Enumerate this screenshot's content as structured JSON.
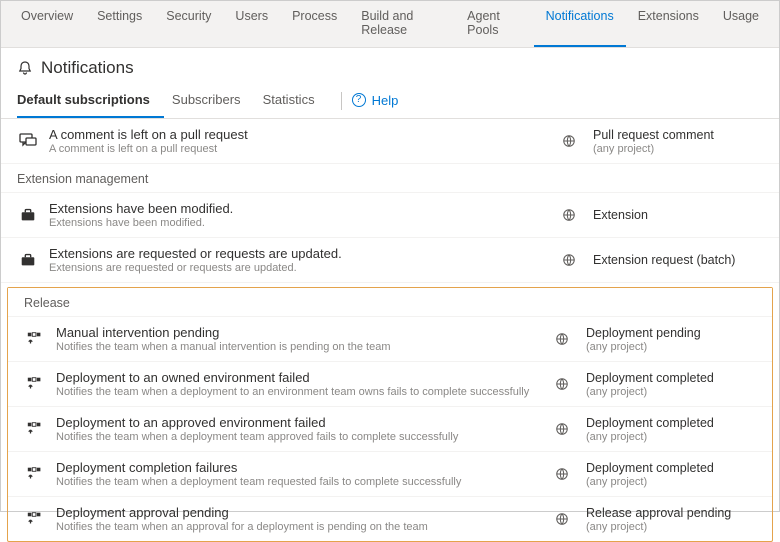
{
  "topnav": {
    "tabs": [
      {
        "label": "Overview"
      },
      {
        "label": "Settings"
      },
      {
        "label": "Security"
      },
      {
        "label": "Users"
      },
      {
        "label": "Process"
      },
      {
        "label": "Build and Release"
      },
      {
        "label": "Agent Pools"
      },
      {
        "label": "Notifications"
      },
      {
        "label": "Extensions"
      },
      {
        "label": "Usage"
      }
    ],
    "selected": "Notifications"
  },
  "page": {
    "title": "Notifications"
  },
  "subnav": {
    "tabs": [
      {
        "label": "Default subscriptions"
      },
      {
        "label": "Subscribers"
      },
      {
        "label": "Statistics"
      }
    ],
    "selected": "Default subscriptions",
    "help": "Help"
  },
  "top_row": {
    "title": "A comment is left on a pull request",
    "desc": "A comment is left on a pull request",
    "category": "Pull request comment",
    "scope": "(any project)"
  },
  "ext_section": {
    "header": "Extension management",
    "rows": [
      {
        "title": "Extensions have been modified.",
        "desc": "Extensions have been modified.",
        "category": "Extension",
        "scope": ""
      },
      {
        "title": "Extensions are requested or requests are updated.",
        "desc": "Extensions are requested or requests are updated.",
        "category": "Extension request (batch)",
        "scope": ""
      }
    ]
  },
  "release_section": {
    "header": "Release",
    "rows": [
      {
        "title": "Manual intervention pending",
        "desc": "Notifies the team when a manual intervention is pending on the team",
        "category": "Deployment pending",
        "scope": "(any project)"
      },
      {
        "title": "Deployment to an owned environment failed",
        "desc": "Notifies the team when a deployment to an environment team owns fails to complete successfully",
        "category": "Deployment completed",
        "scope": "(any project)"
      },
      {
        "title": "Deployment to an approved environment failed",
        "desc": "Notifies the team when a deployment team approved fails to complete successfully",
        "category": "Deployment completed",
        "scope": "(any project)"
      },
      {
        "title": "Deployment completion failures",
        "desc": "Notifies the team when a deployment team requested fails to complete successfully",
        "category": "Deployment completed",
        "scope": "(any project)"
      },
      {
        "title": "Deployment approval pending",
        "desc": "Notifies the team when an approval for a deployment is pending on the team",
        "category": "Release approval pending",
        "scope": "(any project)"
      }
    ]
  }
}
